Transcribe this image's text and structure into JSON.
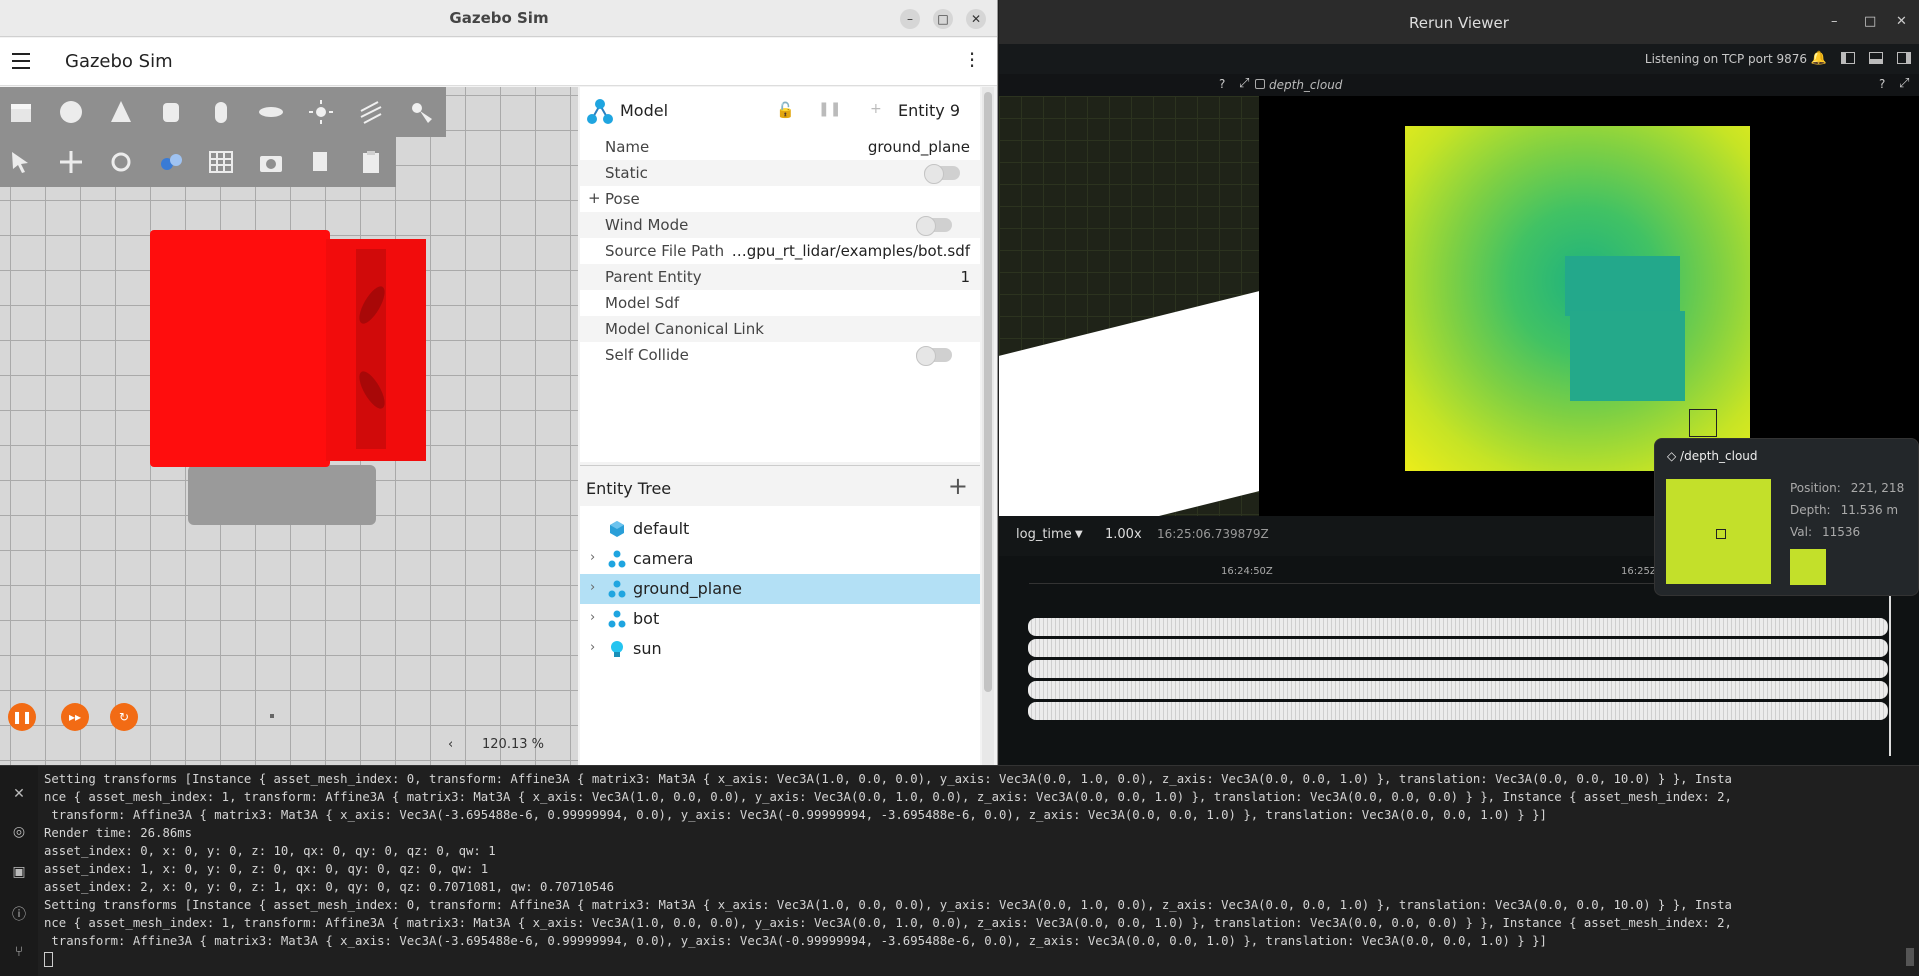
{
  "gazebo": {
    "window_title": "Gazebo Sim",
    "app_title": "Gazebo Sim",
    "zoom_level": "120.13 %",
    "model_panel": {
      "title": "Model",
      "entity": "Entity 9",
      "rows": [
        {
          "key": "Name",
          "value": "ground_plane"
        },
        {
          "key": "Static",
          "value": ""
        },
        {
          "key": "Pose",
          "value": ""
        },
        {
          "key": "Wind Mode",
          "value": ""
        },
        {
          "key": "Source File Path",
          "value": "…gpu_rt_lidar/examples/bot.sdf"
        },
        {
          "key": "Parent Entity",
          "value": "1"
        },
        {
          "key": "Model Sdf",
          "value": ""
        },
        {
          "key": "Model Canonical Link",
          "value": ""
        },
        {
          "key": "Self Collide",
          "value": ""
        }
      ],
      "pose_prefix": "+"
    },
    "entity_tree": {
      "title": "Entity Tree",
      "items": [
        {
          "label": "default",
          "expandable": false,
          "selected": false,
          "icon": "world-icon"
        },
        {
          "label": "camera",
          "expandable": true,
          "selected": false,
          "icon": "model-icon"
        },
        {
          "label": "ground_plane",
          "expandable": true,
          "selected": true,
          "icon": "model-icon"
        },
        {
          "label": "bot",
          "expandable": true,
          "selected": false,
          "icon": "model-icon"
        },
        {
          "label": "sun",
          "expandable": true,
          "selected": false,
          "icon": "light-icon"
        }
      ]
    },
    "accent_color": "#f26b14",
    "selection_color": "#b3e0f5"
  },
  "rerun": {
    "window_title": "Rerun Viewer",
    "status": "Listening on TCP port 9876",
    "view_tab": "depth_cloud",
    "help_mark": "?",
    "timeline": {
      "name": "log_time",
      "speed": "1.00x",
      "current": "16:25:06.739879Z",
      "tick_labels": [
        "16:24:50Z",
        "16:25Z"
      ]
    },
    "tooltip": {
      "entity": "/depth_cloud",
      "position_label": "Position:",
      "position_value": "221, 218",
      "depth_label": "Depth:",
      "depth_value": "11.536 m",
      "val_label": "Val:",
      "val_value": "11536"
    }
  },
  "terminal": {
    "lines": [
      "Setting transforms [Instance { asset_mesh_index: 0, transform: Affine3A { matrix3: Mat3A { x_axis: Vec3A(1.0, 0.0, 0.0), y_axis: Vec3A(0.0, 1.0, 0.0), z_axis: Vec3A(0.0, 0.0, 1.0) }, translation: Vec3A(0.0, 0.0, 10.0) } }, Insta",
      "nce { asset_mesh_index: 1, transform: Affine3A { matrix3: Mat3A { x_axis: Vec3A(1.0, 0.0, 0.0), y_axis: Vec3A(0.0, 1.0, 0.0), z_axis: Vec3A(0.0, 0.0, 1.0) }, translation: Vec3A(0.0, 0.0, 0.0) } }, Instance { asset_mesh_index: 2,",
      " transform: Affine3A { matrix3: Mat3A { x_axis: Vec3A(-3.695488e-6, 0.99999994, 0.0), y_axis: Vec3A(-0.99999994, -3.695488e-6, 0.0), z_axis: Vec3A(0.0, 0.0, 1.0) }, translation: Vec3A(0.0, 0.0, 1.0) } }]",
      "Render time: 26.86ms",
      "asset_index: 0, x: 0, y: 0, z: 10, qx: 0, qy: 0, qz: 0, qw: 1",
      "asset_index: 1, x: 0, y: 0, z: 0, qx: 0, qy: 0, qz: 0, qw: 1",
      "asset_index: 2, x: 0, y: 0, z: 1, qx: 0, qy: 0, qz: 0.7071081, qw: 0.70710546",
      "Setting transforms [Instance { asset_mesh_index: 0, transform: Affine3A { matrix3: Mat3A { x_axis: Vec3A(1.0, 0.0, 0.0), y_axis: Vec3A(0.0, 1.0, 0.0), z_axis: Vec3A(0.0, 0.0, 1.0) }, translation: Vec3A(0.0, 0.0, 10.0) } }, Insta",
      "nce { asset_mesh_index: 1, transform: Affine3A { matrix3: Mat3A { x_axis: Vec3A(1.0, 0.0, 0.0), y_axis: Vec3A(0.0, 1.0, 0.0), z_axis: Vec3A(0.0, 0.0, 1.0) }, translation: Vec3A(0.0, 0.0, 0.0) } }, Instance { asset_mesh_index: 2,",
      " transform: Affine3A { matrix3: Mat3A { x_axis: Vec3A(-3.695488e-6, 0.99999994, 0.0), y_axis: Vec3A(-0.99999994, -3.695488e-6, 0.0), z_axis: Vec3A(0.0, 0.0, 1.0) }, translation: Vec3A(0.0, 0.0, 1.0) } }]"
    ]
  }
}
